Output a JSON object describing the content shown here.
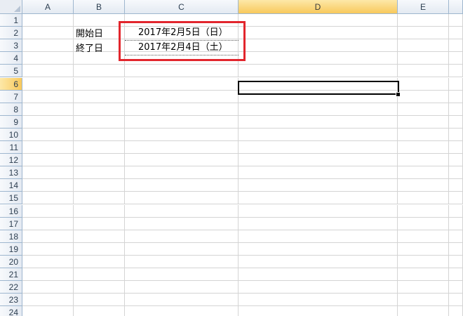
{
  "columns": [
    "A",
    "B",
    "C",
    "D",
    "E"
  ],
  "rows": [
    "1",
    "2",
    "3",
    "4",
    "5",
    "6",
    "7",
    "8",
    "9",
    "10",
    "11",
    "12",
    "13",
    "14",
    "15",
    "16",
    "17",
    "18",
    "19",
    "20",
    "21",
    "22",
    "23",
    "24"
  ],
  "active_column": "D",
  "active_row": "6",
  "cells": {
    "B2": "開始日",
    "B3": "終了日",
    "C2": "2017年2月5日（日）",
    "C3": "2017年2月4日（土）"
  },
  "colors": {
    "highlight_box": "#e2262d",
    "header_bg": "#e4eaf2",
    "active_header_bg": "#f8c95c",
    "gridline": "#d4d4d4"
  }
}
